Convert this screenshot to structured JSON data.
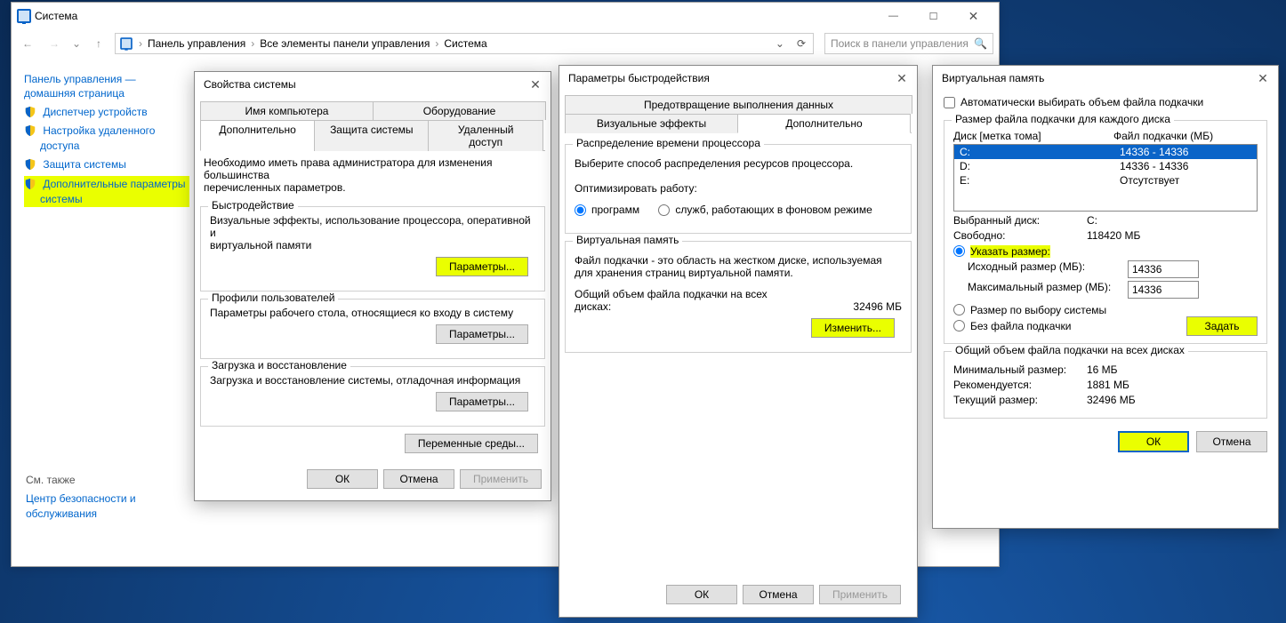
{
  "main_window": {
    "title": "Система",
    "breadcrumb": {
      "p1": "Панель управления",
      "p2": "Все элементы панели управления",
      "p3": "Система"
    },
    "search_placeholder": "Поиск в панели управления",
    "side": {
      "home1": "Панель управления —",
      "home2": "домашняя страница",
      "l1": "Диспетчер устройств",
      "l2a": "Настройка удаленного",
      "l2b": "доступа",
      "l3": "Защита системы",
      "l4a": "Дополнительные параметры",
      "l4b": "системы",
      "see_also": "См. также",
      "sec1": "Центр безопасности и",
      "sec2": "обслуживания"
    }
  },
  "sysprops": {
    "title": "Свойства системы",
    "tabs": {
      "comp_name": "Имя компьютера",
      "hardware": "Оборудование",
      "advanced": "Дополнительно",
      "protection": "Защита системы",
      "remote": "Удаленный доступ"
    },
    "note1": "Необходимо иметь права администратора для изменения большинства",
    "note2": "перечисленных параметров.",
    "perf": {
      "legend": "Быстродействие",
      "desc1": "Визуальные эффекты, использование процессора, оперативной и",
      "desc2": "виртуальной памяти",
      "btn": "Параметры..."
    },
    "profiles": {
      "legend": "Профили пользователей",
      "desc": "Параметры рабочего стола, относящиеся ко входу в систему",
      "btn": "Параметры..."
    },
    "boot": {
      "legend": "Загрузка и восстановление",
      "desc": "Загрузка и восстановление системы, отладочная информация",
      "btn": "Параметры..."
    },
    "env_btn": "Переменные среды...",
    "ok": "ОК",
    "cancel": "Отмена",
    "apply": "Применить"
  },
  "perf_options": {
    "title": "Параметры быстродействия",
    "tabs": {
      "dep": "Предотвращение выполнения данных",
      "visual": "Визуальные эффекты",
      "advanced": "Дополнительно"
    },
    "sched": {
      "legend": "Распределение времени процессора",
      "desc": "Выберите способ распределения ресурсов процессора.",
      "opt_label": "Оптимизировать работу:",
      "r1": "программ",
      "r2": "служб, работающих в фоновом режиме"
    },
    "vm": {
      "legend": "Виртуальная память",
      "desc1": "Файл подкачки - это область на жестком диске, используемая",
      "desc2": "для хранения страниц виртуальной памяти.",
      "total_lbl1": "Общий объем файла подкачки на всех",
      "total_lbl2": "дисках:",
      "total_val": "32496 МБ",
      "btn": "Изменить..."
    },
    "ok": "ОК",
    "cancel": "Отмена",
    "apply": "Применить"
  },
  "vmem": {
    "title": "Виртуальная память",
    "auto": "Автоматически выбирать объем файла подкачки",
    "each_drive": "Размер файла подкачки для каждого диска",
    "col1": "Диск [метка тома]",
    "col2": "Файл подкачки (МБ)",
    "rows": [
      {
        "drive": "C:",
        "val": "14336 - 14336"
      },
      {
        "drive": "D:",
        "val": "14336 - 14336"
      },
      {
        "drive": "E:",
        "val": "Отсутствует"
      }
    ],
    "selected_lbl": "Выбранный диск:",
    "selected_val": "C:",
    "free_lbl": "Свободно:",
    "free_val": "118420 МБ",
    "r_custom": "Указать размер:",
    "init_lbl": "Исходный размер (МБ):",
    "init_val": "14336",
    "max_lbl": "Максимальный размер (МБ):",
    "max_val": "14336",
    "r_system": "Размер по выбору системы",
    "r_none": "Без файла подкачки",
    "set_btn": "Задать",
    "total_legend": "Общий объем файла подкачки на всех дисках",
    "min_lbl": "Минимальный размер:",
    "min_val": "16 МБ",
    "rec_lbl": "Рекомендуется:",
    "rec_val": "1881 МБ",
    "cur_lbl": "Текущий размер:",
    "cur_val": "32496 МБ",
    "ok": "ОК",
    "cancel": "Отмена"
  }
}
